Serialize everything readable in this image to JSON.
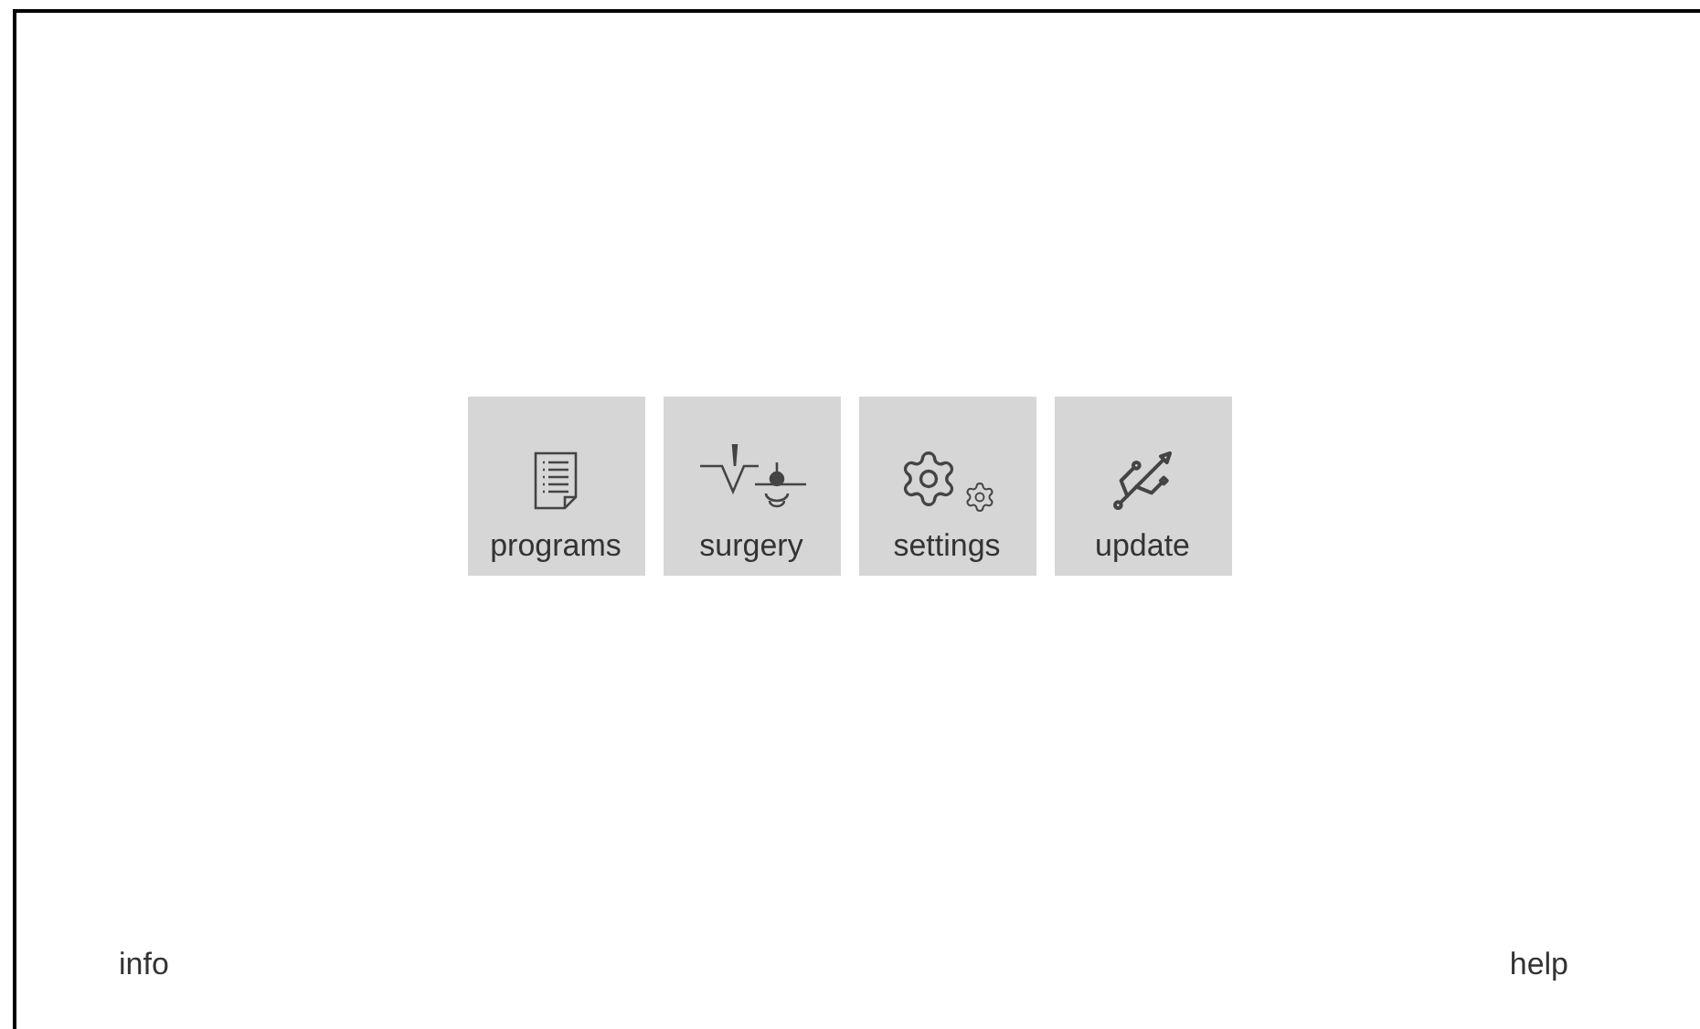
{
  "menu": [
    {
      "label": "programs",
      "kind": "list"
    },
    {
      "label": "surgery",
      "kind": "surgery"
    },
    {
      "label": "settings",
      "kind": "gears"
    },
    {
      "label": "update",
      "kind": "usb"
    }
  ],
  "footer": {
    "left": "info",
    "right": "help"
  }
}
